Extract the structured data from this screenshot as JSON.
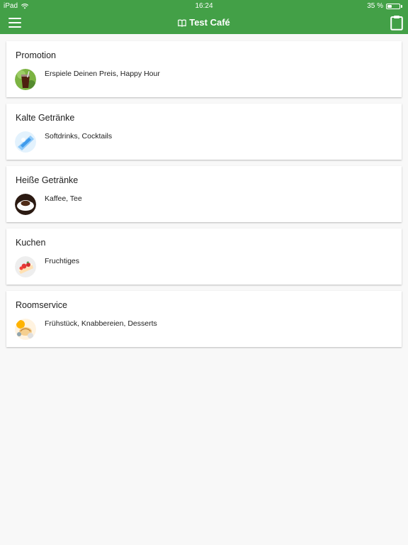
{
  "status": {
    "device": "iPad",
    "time": "16:24",
    "battery": "35 %",
    "battery_level": 0.35
  },
  "appbar": {
    "title": "Test Café",
    "menu_icon": "hamburger-menu-icon",
    "title_icon": "book-icon",
    "cart_icon": "clipboard-icon"
  },
  "colors": {
    "primary": "#43a047",
    "background": "#f8f8f8"
  },
  "categories": [
    {
      "title": "Promotion",
      "subtitle": "Erspiele Deinen Preis, Happy Hour",
      "image": "cola-drink-thumbnail"
    },
    {
      "title": "Kalte Getränke",
      "subtitle": "Softdrinks, Cocktails",
      "image": "water-glass-thumbnail"
    },
    {
      "title": "Heiße Getränke",
      "subtitle": "Kaffee, Tee",
      "image": "coffee-cup-thumbnail"
    },
    {
      "title": "Kuchen",
      "subtitle": "Fruchtiges",
      "image": "strawberry-cake-thumbnail"
    },
    {
      "title": "Roomservice",
      "subtitle": "Frühstück, Knabbereien, Desserts",
      "image": "breakfast-thumbnail"
    }
  ]
}
